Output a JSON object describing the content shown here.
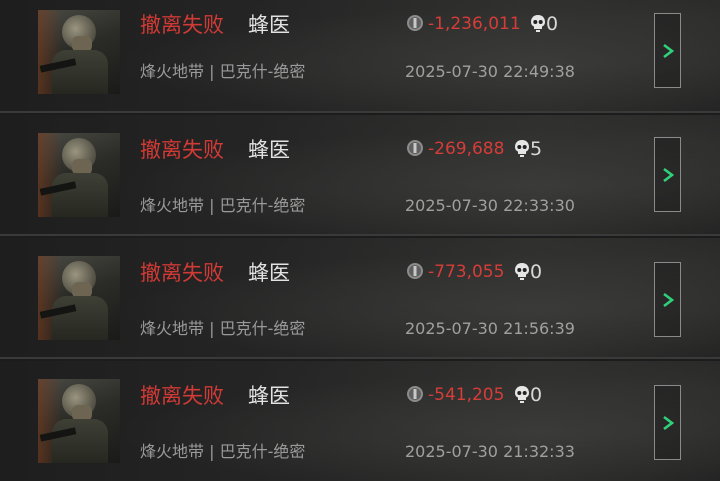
{
  "records": [
    {
      "status": "撤离失败",
      "operator": "蜂医",
      "value": "-1,236,011",
      "kills": "0",
      "map": "烽火地带 | 巴克什-绝密",
      "time": "2025-07-30 22:49:38",
      "detail_icon": "chevron-right-icon"
    },
    {
      "status": "撤离失败",
      "operator": "蜂医",
      "value": "-269,688",
      "kills": "5",
      "map": "烽火地带 | 巴克什-绝密",
      "time": "2025-07-30 22:33:30",
      "detail_icon": "chevron-right-icon"
    },
    {
      "status": "撤离失败",
      "operator": "蜂医",
      "value": "-773,055",
      "kills": "0",
      "map": "烽火地带 | 巴克什-绝密",
      "time": "2025-07-30 21:56:39",
      "detail_icon": "chevron-right-icon"
    },
    {
      "status": "撤离失败",
      "operator": "蜂医",
      "value": "-541,205",
      "kills": "0",
      "map": "烽火地带 | 巴克什-绝密",
      "time": "2025-07-30 21:32:33",
      "detail_icon": "chevron-right-icon"
    }
  ],
  "colors": {
    "fail": "#d23a36",
    "value_negative": "#d63d38",
    "accent_green": "#2fd27a"
  }
}
